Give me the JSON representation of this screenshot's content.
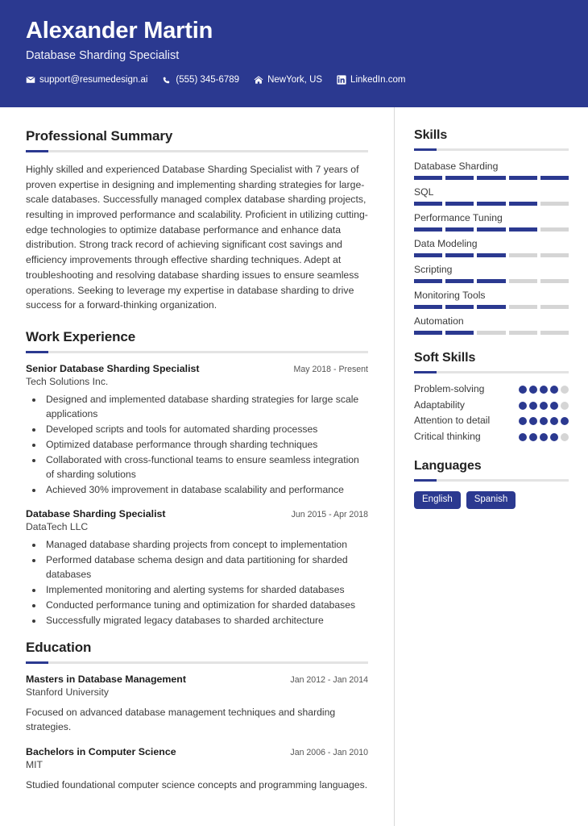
{
  "theme": {
    "accent": "#2b3990",
    "bar_empty": "#d5d5d5",
    "rule": "#e3e3e3",
    "divider": "#d8d8d8",
    "text": "#3a3a3a"
  },
  "header": {
    "name": "Alexander Martin",
    "title": "Database Sharding Specialist",
    "contacts": [
      {
        "icon": "envelope-icon",
        "label": "support@resumedesign.ai"
      },
      {
        "icon": "phone-icon",
        "label": "(555) 345-6789"
      },
      {
        "icon": "home-icon",
        "label": "NewYork, US"
      },
      {
        "icon": "linkedin-icon",
        "label": "LinkedIn.com"
      }
    ]
  },
  "summary": {
    "heading": "Professional Summary",
    "text": "Highly skilled and experienced Database Sharding Specialist with 7 years of proven expertise in designing and implementing sharding strategies for large-scale databases. Successfully managed complex database sharding projects, resulting in improved performance and scalability. Proficient in utilizing cutting-edge technologies to optimize database performance and enhance data distribution. Strong track record of achieving significant cost savings and efficiency improvements through effective sharding techniques. Adept at troubleshooting and resolving database sharding issues to ensure seamless operations. Seeking to leverage my expertise in database sharding to drive success for a forward-thinking organization."
  },
  "experience": {
    "heading": "Work Experience",
    "entries": [
      {
        "title": "Senior Database Sharding Specialist",
        "date": "May 2018 - Present",
        "org": "Tech Solutions Inc.",
        "bullets": [
          "Designed and implemented database sharding strategies for large scale applications",
          "Developed scripts and tools for automated sharding processes",
          "Optimized database performance through sharding techniques",
          "Collaborated with cross-functional teams to ensure seamless integration of sharding solutions",
          "Achieved 30% improvement in database scalability and performance"
        ]
      },
      {
        "title": "Database Sharding Specialist",
        "date": "Jun 2015 - Apr 2018",
        "org": "DataTech LLC",
        "bullets": [
          "Managed database sharding projects from concept to implementation",
          "Performed database schema design and data partitioning for sharded databases",
          "Implemented monitoring and alerting systems for sharded databases",
          "Conducted performance tuning and optimization for sharded databases",
          "Successfully migrated legacy databases to sharded architecture"
        ]
      }
    ]
  },
  "education": {
    "heading": "Education",
    "entries": [
      {
        "title": "Masters in Database Management",
        "date": "Jan 2012 - Jan 2014",
        "org": "Stanford University",
        "desc": "Focused on advanced database management techniques and sharding strategies."
      },
      {
        "title": "Bachelors in Computer Science",
        "date": "Jan 2006 - Jan 2010",
        "org": "MIT",
        "desc": "Studied foundational computer science concepts and programming languages."
      }
    ]
  },
  "skills": {
    "heading": "Skills",
    "max": 5,
    "items": [
      {
        "name": "Database Sharding",
        "level": 5
      },
      {
        "name": "SQL",
        "level": 4
      },
      {
        "name": "Performance Tuning",
        "level": 4
      },
      {
        "name": "Data Modeling",
        "level": 3
      },
      {
        "name": "Scripting",
        "level": 3
      },
      {
        "name": "Monitoring Tools",
        "level": 3
      },
      {
        "name": "Automation",
        "level": 2
      }
    ]
  },
  "soft_skills": {
    "heading": "Soft Skills",
    "max": 5,
    "items": [
      {
        "name": "Problem-solving",
        "level": 4
      },
      {
        "name": "Adaptability",
        "level": 4
      },
      {
        "name": "Attention to detail",
        "level": 5
      },
      {
        "name": "Critical thinking",
        "level": 4
      }
    ]
  },
  "languages": {
    "heading": "Languages",
    "items": [
      "English",
      "Spanish"
    ]
  }
}
